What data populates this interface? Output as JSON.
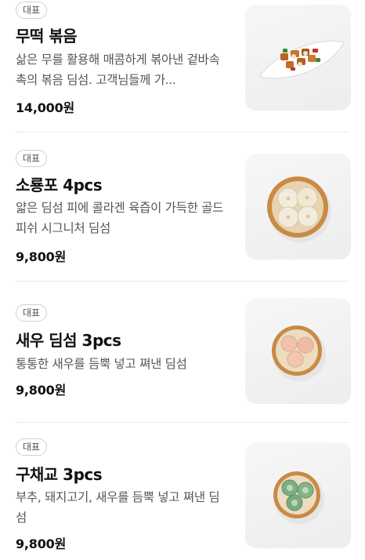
{
  "menu": {
    "items": [
      {
        "badge": "대표",
        "title": "무떡 볶음",
        "description": "삶은 무를 활용해 매콤하게 볶아낸 겉바속촉의 볶음 딤섬. 고객님들께 가...",
        "price": "14,000원",
        "image_icon": "stir-fried-dish-photo"
      },
      {
        "badge": "대표",
        "title": "소룡포 4pcs",
        "description": "얇은 딤섬 피에 콜라겐 육즙이 가득한 골드피쉬 시그니처 딤섬",
        "price": "9,800원",
        "image_icon": "steamer-basket-dumplings-photo"
      },
      {
        "badge": "대표",
        "title": "새우 딤섬 3pcs",
        "description": "통통한 새우를 듬뿍 넣고 쪄낸 딤섬",
        "price": "9,800원",
        "image_icon": "steamer-basket-shrimp-dumplings-photo"
      },
      {
        "badge": "대표",
        "title": "구채교 3pcs",
        "description": "부추, 돼지고기, 새우를 듬뿍 넣고 쪄낸 딤섬",
        "price": "9,800원",
        "image_icon": "steamer-basket-chive-dumplings-photo"
      }
    ]
  }
}
